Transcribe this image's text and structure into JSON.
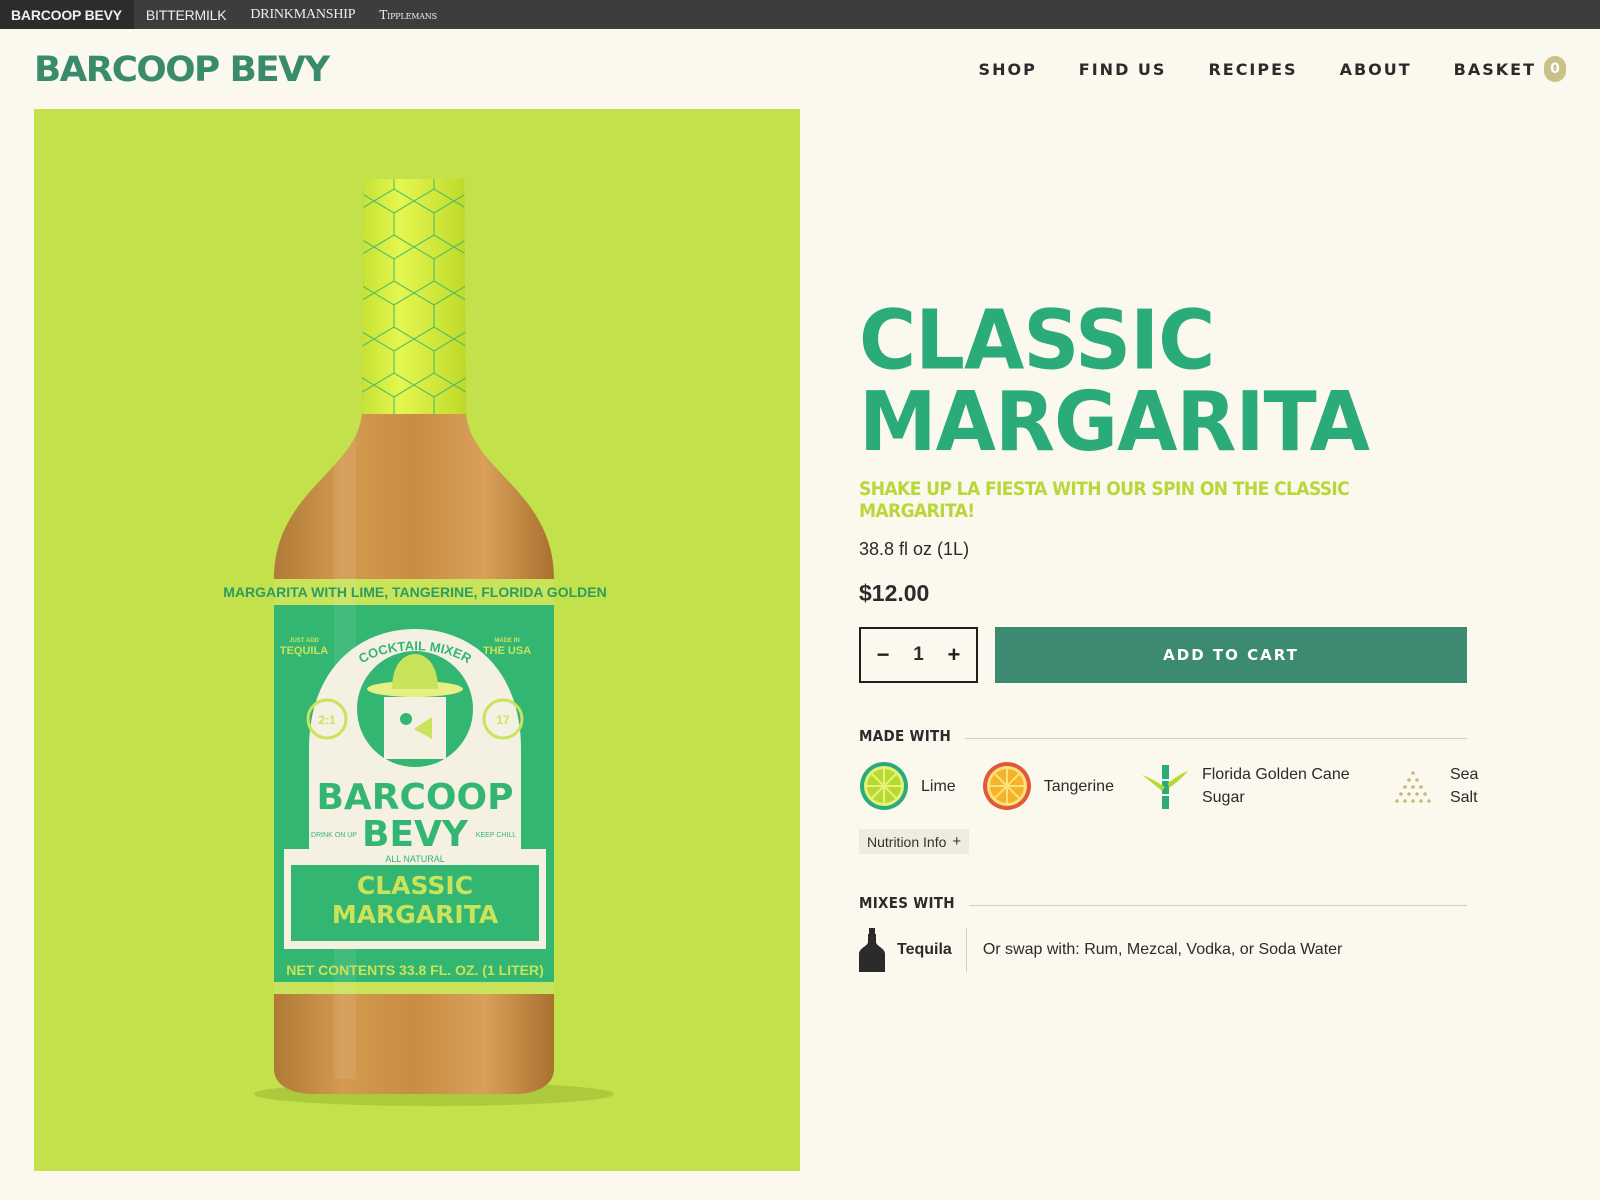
{
  "brandbar": {
    "brands": [
      "BARCOOP BEVY",
      "BITTERMILK",
      "DRINKMANSHIP",
      "Tipplemans"
    ]
  },
  "header": {
    "logo": "BARCOOP BEVY",
    "nav": [
      "SHOP",
      "FIND US",
      "RECIPES",
      "ABOUT"
    ],
    "basket_label": "BASKET",
    "basket_count": "0"
  },
  "bottle_label": {
    "band_text": "MARGARITA WITH LIME, TANGERINE, FLORIDA GOLDEN",
    "left_badge_small": "JUST ADD",
    "left_badge": "TEQUILA",
    "right_badge_small": "MADE IN",
    "right_badge": "THE USA",
    "arc_text": "COCKTAIL MIXER",
    "ratio": "2:1",
    "proof": "17",
    "brand_line1": "BARCOOP",
    "brand_line2": "BEVY",
    "drink_on_up": "DRINK ON UP",
    "keep_chill": "KEEP CHILL",
    "all_natural": "ALL NATURAL",
    "flavor_line1": "CLASSIC",
    "flavor_line2": "MARGARITA",
    "net_contents": "NET CONTENTS 33.8 FL. OZ. (1 LITER)"
  },
  "product": {
    "title_line1": "CLASSIC",
    "title_line2": "MARGARITA",
    "tagline": "SHAKE UP LA FIESTA WITH OUR SPIN ON THE CLASSIC MARGARITA!",
    "volume": "38.8 fl oz (1L)",
    "price": "$12.00",
    "quantity": "1",
    "minus": "−",
    "plus": "+",
    "add_to_cart": "ADD TO CART"
  },
  "made_with": {
    "heading": "MADE WITH",
    "items": [
      {
        "label": "Lime",
        "icon": "lime-icon"
      },
      {
        "label": "Tangerine",
        "icon": "tangerine-icon"
      },
      {
        "label": "Florida Golden Cane Sugar",
        "icon": "sugar-cane-icon"
      },
      {
        "label": "Sea Salt",
        "icon": "sea-salt-icon"
      }
    ],
    "nutrition_label": "Nutrition Info",
    "nutrition_plus": "+"
  },
  "mixes_with": {
    "heading": "MIXES WITH",
    "spirit": "Tequila",
    "spirit_icon": "tequila-bottle-icon",
    "swap_text": "Or swap with: Rum, Mezcal, Vodka, or Soda Water"
  },
  "colors": {
    "accent_green": "#2bab79",
    "button_green": "#3d8a72",
    "lime_yellow": "#c3e14b",
    "tagline_lime": "#b9d63a",
    "background": "#fbf8ee"
  }
}
